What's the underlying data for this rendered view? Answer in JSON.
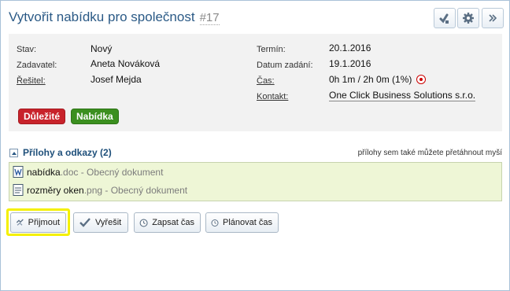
{
  "header": {
    "title": "Vytvořit nabídku pro společnost",
    "ticket_id": "#17",
    "buttons": [
      "assign-icon",
      "gear-icon",
      "double-chevron-right-icon"
    ]
  },
  "details": {
    "left": [
      {
        "label": "Stav:",
        "value": "Nový"
      },
      {
        "label": "Zadavatel:",
        "value": "Aneta Nováková"
      },
      {
        "label": "Řešitel:",
        "value": "Josef Mejda"
      }
    ],
    "right": [
      {
        "label": "Termín:",
        "value": "20.1.2016"
      },
      {
        "label": "Datum zadání:",
        "value": "19.1.2016"
      },
      {
        "label": "Čas:",
        "value": "0h 1m / 2h 0m (1%)"
      },
      {
        "label": "Kontakt:",
        "value": "One Click Business Solutions s.r.o."
      }
    ],
    "tags": [
      {
        "label": "Důležité",
        "color": "#c8232b"
      },
      {
        "label": "Nabídka",
        "color": "#3b8f1f"
      }
    ]
  },
  "attachments": {
    "title": "Přílohy a odkazy (2)",
    "hint": "přílohy sem také můžete přetáhnout myší",
    "files": [
      {
        "name": "nabídka",
        "ext": ".doc",
        "desc": " - Obecný dokument",
        "icon": "word-document-icon"
      },
      {
        "name": "rozměry oken",
        "ext": ".png",
        "desc": " - Obecný dokument",
        "icon": "image-file-icon"
      }
    ]
  },
  "actions": [
    {
      "label": "Přijmout",
      "icon": "accept-icon",
      "highlight_color": "#f4f000"
    },
    {
      "label": "Vyřešit",
      "icon": "checkmark-icon"
    },
    {
      "label": "Zapsat čas",
      "icon": "clock-icon"
    },
    {
      "label": "Plánovat čas",
      "icon": "clock-icon"
    }
  ]
}
